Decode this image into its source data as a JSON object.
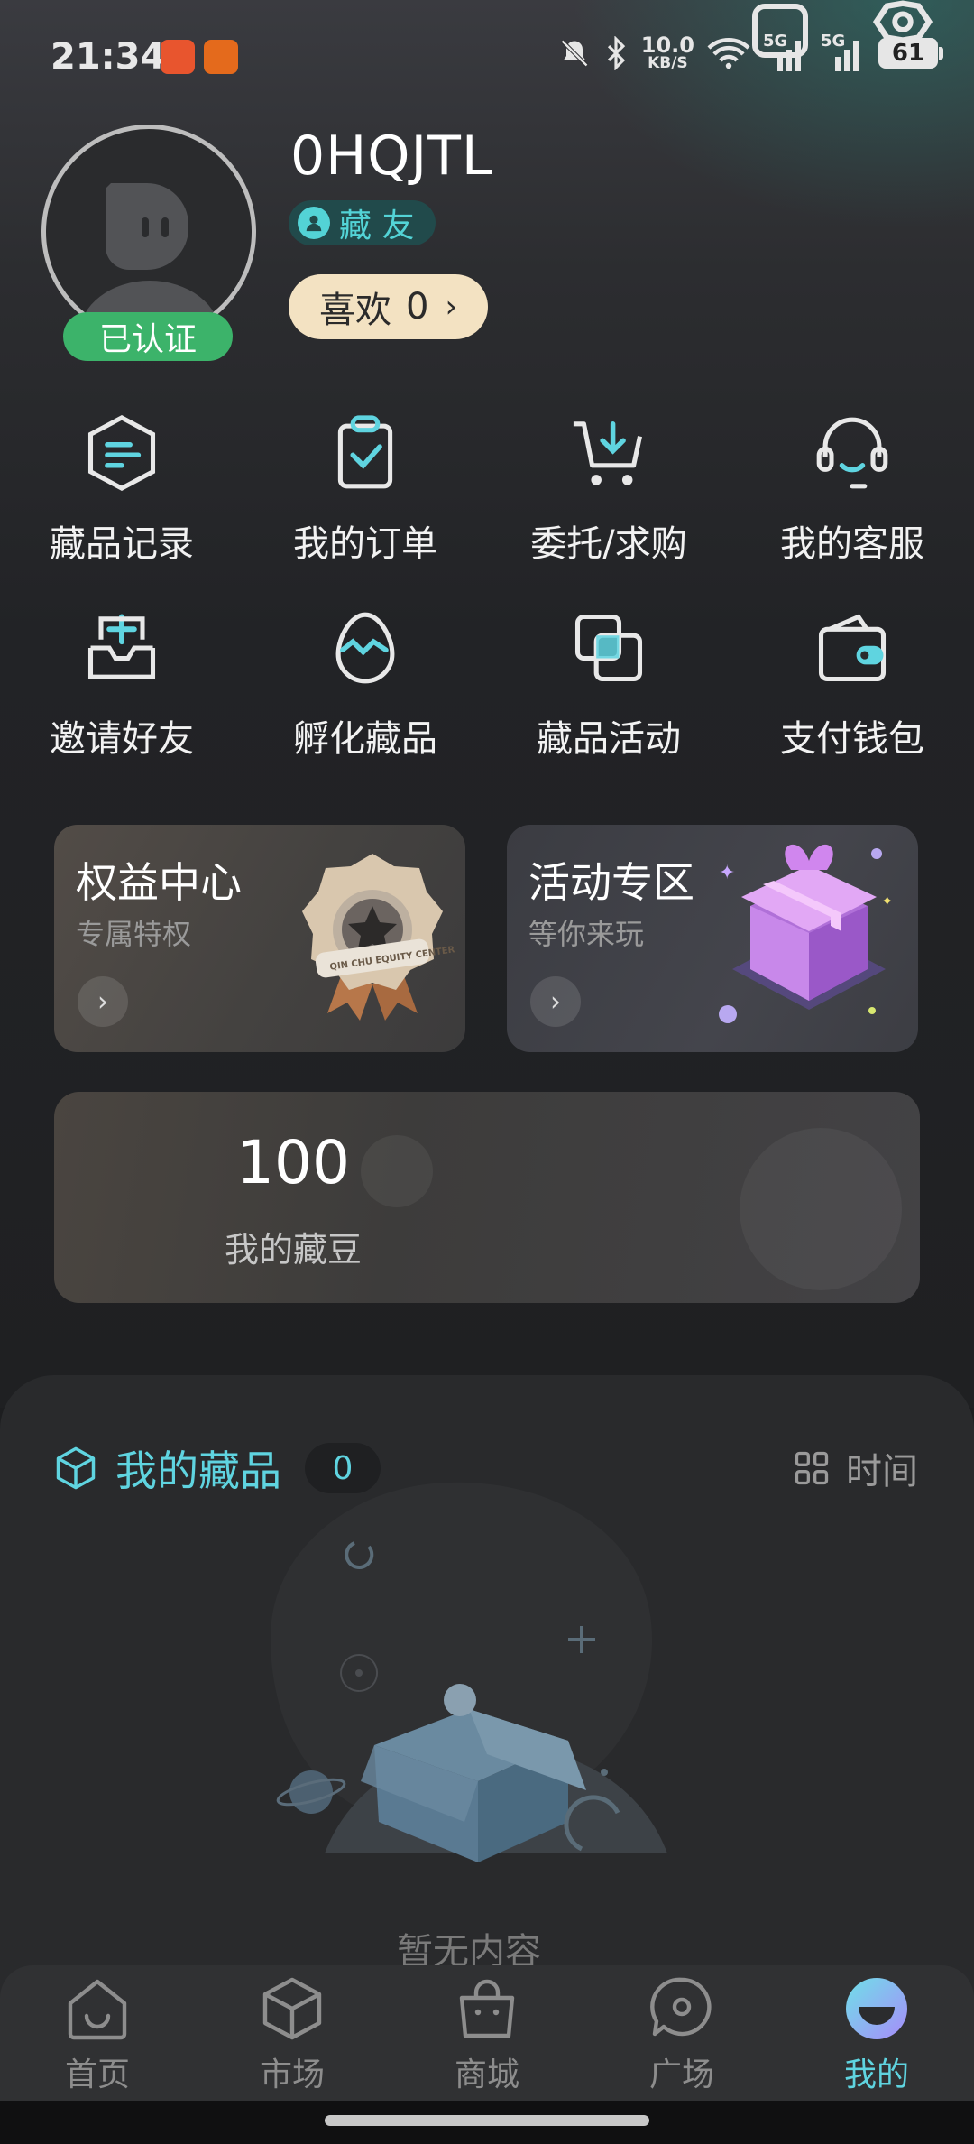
{
  "status_bar": {
    "time": "21:34",
    "net_speed_value": "10.0",
    "net_speed_unit": "KB/S",
    "signal_1": "5G",
    "signal_2": "5G",
    "battery": "61",
    "icons": [
      "mute-bell-icon",
      "bluetooth-icon",
      "wifi-icon",
      "signal-icon",
      "signal-icon",
      "battery-icon"
    ]
  },
  "profile": {
    "username": "0HQJTL",
    "verified_label": "已认证",
    "member_level": "藏 友",
    "likes_label": "喜欢",
    "likes_count": "0"
  },
  "menu": [
    {
      "label": "藏品记录",
      "icon": "collection-record-icon"
    },
    {
      "label": "我的订单",
      "icon": "order-clipboard-icon"
    },
    {
      "label": "委托/求购",
      "icon": "cart-download-icon"
    },
    {
      "label": "我的客服",
      "icon": "headset-icon"
    },
    {
      "label": "邀请好友",
      "icon": "invite-inbox-icon"
    },
    {
      "label": "孵化藏品",
      "icon": "egg-icon"
    },
    {
      "label": "藏品活动",
      "icon": "layers-icon"
    },
    {
      "label": "支付钱包",
      "icon": "wallet-icon"
    }
  ],
  "cards": {
    "equity": {
      "title": "权益中心",
      "subtitle": "专属特权",
      "badge_text": "QIN CHU EQUITY CENTER"
    },
    "activity": {
      "title": "活动专区",
      "subtitle": "等你来玩"
    }
  },
  "beans": {
    "value": "100",
    "label": "我的藏豆"
  },
  "collection": {
    "title": "我的藏品",
    "count": "0",
    "sort_label": "时间",
    "empty_text": "暂无内容"
  },
  "tabs": [
    {
      "label": "首页",
      "icon": "home-icon"
    },
    {
      "label": "市场",
      "icon": "cube-icon"
    },
    {
      "label": "商城",
      "icon": "shopping-bag-icon"
    },
    {
      "label": "广场",
      "icon": "chat-bubble-icon"
    },
    {
      "label": "我的",
      "icon": "profile-face-icon",
      "active": true
    }
  ],
  "colors": {
    "accent": "#5fd4e0",
    "verified": "#3cb36a",
    "likes_bg": "#f3e2c2"
  }
}
